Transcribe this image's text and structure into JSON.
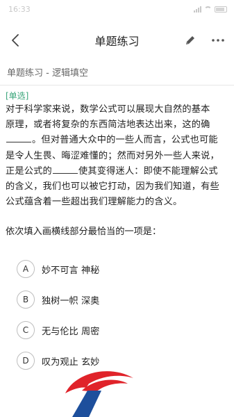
{
  "status_bar": {
    "time": "16:33"
  },
  "nav": {
    "title": "单题练习"
  },
  "breadcrumb": "单题练习 - 逻辑填空",
  "question": {
    "tag": "[单选]",
    "line1": "对于科学家来说，数学公式可以展现大自然的基本",
    "line2": "原理，或者将复杂的东西简洁地表达出来，这的确",
    "line3_after": "。但对普通大众中的一些人而言，公式也可能",
    "line4": "是令人生畏、晦涩难懂的；然而对另外一些人来说，",
    "line5_before": "正是公式的",
    "line5_after": "使其变得迷人：即使不能理解公式",
    "line6": "的含义，我们也可以被它打动，因为我们知道，有些",
    "line7": "公式蕴含着一些超出我们理解能力的含义。",
    "prompt": "依次填入画横线部分最恰当的一项是："
  },
  "options": [
    {
      "letter": "A",
      "text": "妙不可言 神秘"
    },
    {
      "letter": "B",
      "text": "独树一帜 深奥"
    },
    {
      "letter": "C",
      "text": "无与伦比 周密"
    },
    {
      "letter": "D",
      "text": "叹为观止 玄妙"
    }
  ],
  "colors": {
    "tag": "#3aa57a",
    "watermark_red": "#e0232a",
    "watermark_blue": "#1d4f9c"
  }
}
